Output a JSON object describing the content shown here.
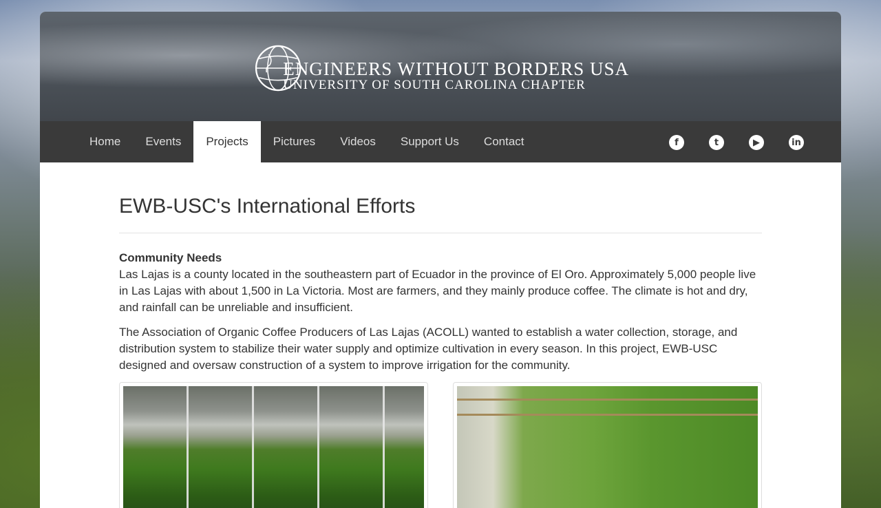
{
  "header": {
    "logo_line1": "ENGINEERS WITHOUT BORDERS USA",
    "logo_line2": "UNIVERSITY OF SOUTH CAROLINA CHAPTER"
  },
  "nav": {
    "items": [
      {
        "label": "Home"
      },
      {
        "label": "Events"
      },
      {
        "label": "Projects",
        "active": true
      },
      {
        "label": "Pictures"
      },
      {
        "label": "Videos"
      },
      {
        "label": "Support Us"
      },
      {
        "label": "Contact"
      }
    ],
    "social": [
      {
        "icon": "facebook-icon",
        "glyph": "f"
      },
      {
        "icon": "twitter-icon",
        "glyph": "t"
      },
      {
        "icon": "youtube-icon",
        "glyph": "▶"
      },
      {
        "icon": "linkedin-icon",
        "glyph": "in"
      }
    ]
  },
  "main": {
    "title": "EWB-USC's International Efforts",
    "section_heading": "Community Needs",
    "paragraph1": "Las Lajas is a county located in the southeastern part of Ecuador in the province of El Oro. Approximately 5,000 people live in Las Lajas with about 1,500 in La Victoria. Most are farmers, and they mainly produce coffee. The climate is hot and dry, and rainfall can be unreliable and insufficient.",
    "paragraph2": "The Association of Organic Coffee Producers of Las Lajas (ACOLL) wanted to establish a water collection, storage, and distribution system to stabilize their water supply and optimize cultivation in every season. In this project, EWB-USC designed and oversaw construction of a system to improve irrigation for the community."
  },
  "colors": {
    "navbar": "#3a3a3a",
    "nav_text": "#dddddd",
    "text": "#333333"
  }
}
